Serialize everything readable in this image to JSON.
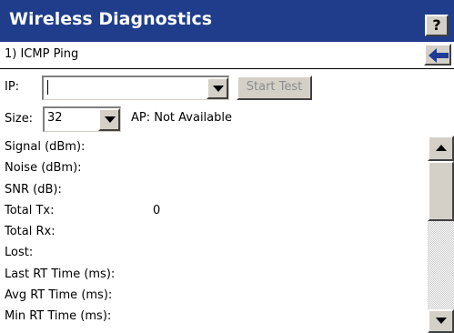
{
  "header": {
    "title": "Wireless Diagnostics",
    "help_label": "?"
  },
  "subheader": {
    "label": "1) ICMP Ping"
  },
  "ip": {
    "label": "IP:",
    "value": ""
  },
  "start_button": {
    "label": "Start Test",
    "enabled": false
  },
  "size": {
    "label": "Size:",
    "value": "32"
  },
  "ap_status": "AP: Not Available",
  "stats": [
    {
      "label": "Signal (dBm):",
      "value": ""
    },
    {
      "label": "Noise (dBm):",
      "value": ""
    },
    {
      "label": "SNR (dB):",
      "value": ""
    },
    {
      "label": "Total Tx:",
      "value": "0"
    },
    {
      "label": "Total Rx:",
      "value": ""
    },
    {
      "label": "Lost:",
      "value": ""
    },
    {
      "label": "Last RT Time (ms):",
      "value": ""
    },
    {
      "label": "Avg RT Time (ms):",
      "value": ""
    },
    {
      "label": "Min RT Time (ms):",
      "value": ""
    }
  ],
  "colors": {
    "titlebar": "#1f3d8a",
    "back_arrow": "#1e3c96",
    "button_face": "#d4d0c8",
    "disabled_text": "#8c8c8c"
  },
  "icons": {
    "help": "question-mark-icon",
    "back": "back-arrow-icon",
    "dropdown": "chevron-down-icon",
    "scroll_up": "scroll-up-icon",
    "scroll_down": "scroll-down-icon"
  }
}
